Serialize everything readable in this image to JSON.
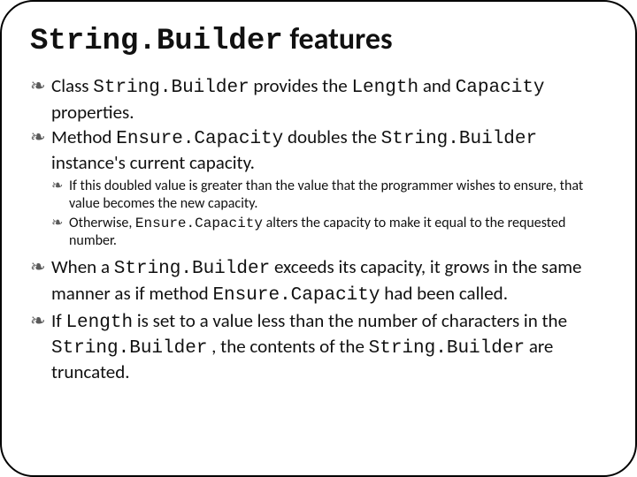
{
  "title": {
    "part1_code": "String.Builder",
    "part2": " features"
  },
  "bullets": [
    {
      "runs": [
        {
          "t": "Class ",
          "c": false
        },
        {
          "t": "String.Builder",
          "c": true
        },
        {
          "t": " provides the ",
          "c": false
        },
        {
          "t": "Length",
          "c": true
        },
        {
          "t": " and ",
          "c": false
        },
        {
          "t": "Capacity",
          "c": true
        },
        {
          "t": " properties.",
          "c": false
        }
      ]
    },
    {
      "runs": [
        {
          "t": "Method ",
          "c": false
        },
        {
          "t": "Ensure.Capacity",
          "c": true
        },
        {
          "t": " doubles the ",
          "c": false
        },
        {
          "t": "String.Builder",
          "c": true
        },
        {
          "t": " instance's current capacity.",
          "c": false
        }
      ],
      "sub": [
        {
          "runs": [
            {
              "t": "If this doubled value is greater than the value that the programmer wishes to ensure, that value becomes the new capacity.",
              "c": false
            }
          ]
        },
        {
          "runs": [
            {
              "t": "Otherwise, ",
              "c": false
            },
            {
              "t": "Ensure.Capacity",
              "c": true
            },
            {
              "t": " alters the capacity to make it equal to the requested number.",
              "c": false
            }
          ]
        }
      ]
    },
    {
      "runs": [
        {
          "t": "When a ",
          "c": false
        },
        {
          "t": "String.Builder",
          "c": true
        },
        {
          "t": " exceeds its capacity, it grows in the same manner as if method ",
          "c": false
        },
        {
          "t": "Ensure.Capacity",
          "c": true
        },
        {
          "t": " had been called.",
          "c": false
        }
      ]
    },
    {
      "runs": [
        {
          "t": "If ",
          "c": false
        },
        {
          "t": "Length",
          "c": true
        },
        {
          "t": " is set to a value less than the number of characters in the ",
          "c": false
        },
        {
          "t": "String.Builder",
          "c": true
        },
        {
          "t": " , the contents of the ",
          "c": false
        },
        {
          "t": "String.Builder",
          "c": true
        },
        {
          "t": " are truncated.",
          "c": false
        }
      ]
    }
  ]
}
